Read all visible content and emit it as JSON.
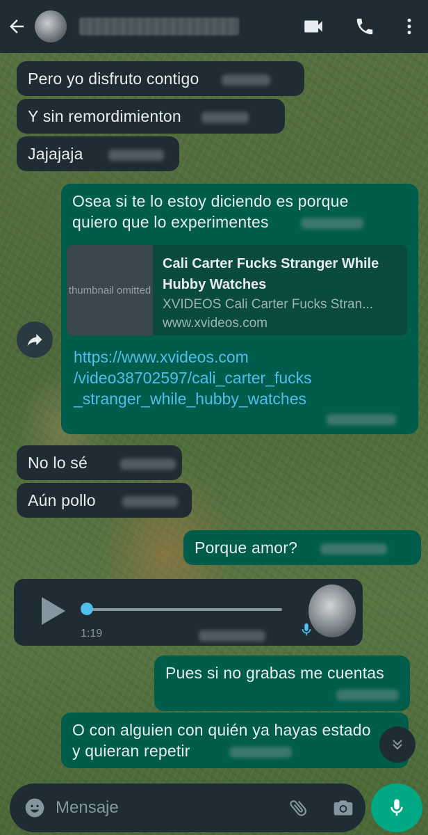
{
  "header": {
    "contact_name": "",
    "icons": [
      "back-arrow-icon",
      "video-call-icon",
      "phone-icon",
      "more-vertical-icon"
    ]
  },
  "messages": [
    {
      "dir": "in",
      "text": "Pero yo disfruto contigo"
    },
    {
      "dir": "in",
      "text": "Y sin remordimienton"
    },
    {
      "dir": "in",
      "text": "Jajajaja"
    },
    {
      "dir": "out",
      "text_line1": "Osea si te lo estoy diciendo es porque",
      "text_line2": "quiero que lo experimentes"
    },
    {
      "dir": "in",
      "text": "No lo sé"
    },
    {
      "dir": "in",
      "text": "Aún pollo"
    },
    {
      "dir": "out",
      "text": "Porque amor?"
    },
    {
      "dir": "out",
      "text": "Pues si no grabas me cuentas"
    },
    {
      "dir": "out",
      "text_line1": "O con alguien con quién ya hayas estado",
      "text_line2": "y quieran repetir"
    }
  ],
  "link_message": {
    "preview_title": "Cali Carter Fucks Stranger While Hubby Watches",
    "preview_description": "XVIDEOS Cali Carter Fucks Stran...",
    "preview_host": "www.xvideos.com",
    "thumbnail_note": "thumbnail omitted",
    "url_line1": "https://www.xvideos.com",
    "url_line2": "/video38702597/cali_carter_fucks",
    "url_line3": "_stranger_while_hubby_watches"
  },
  "voice_note": {
    "duration": "1:19",
    "progress": 0
  },
  "input": {
    "placeholder": "Mensaje"
  },
  "colors": {
    "header_bg": "#1f2c34",
    "incoming_bg": "#1f2c34",
    "outgoing_bg": "#005c4b",
    "link_color": "#53bdeb",
    "mic_button": "#00a884",
    "voice_progress": "#53bdeb"
  }
}
